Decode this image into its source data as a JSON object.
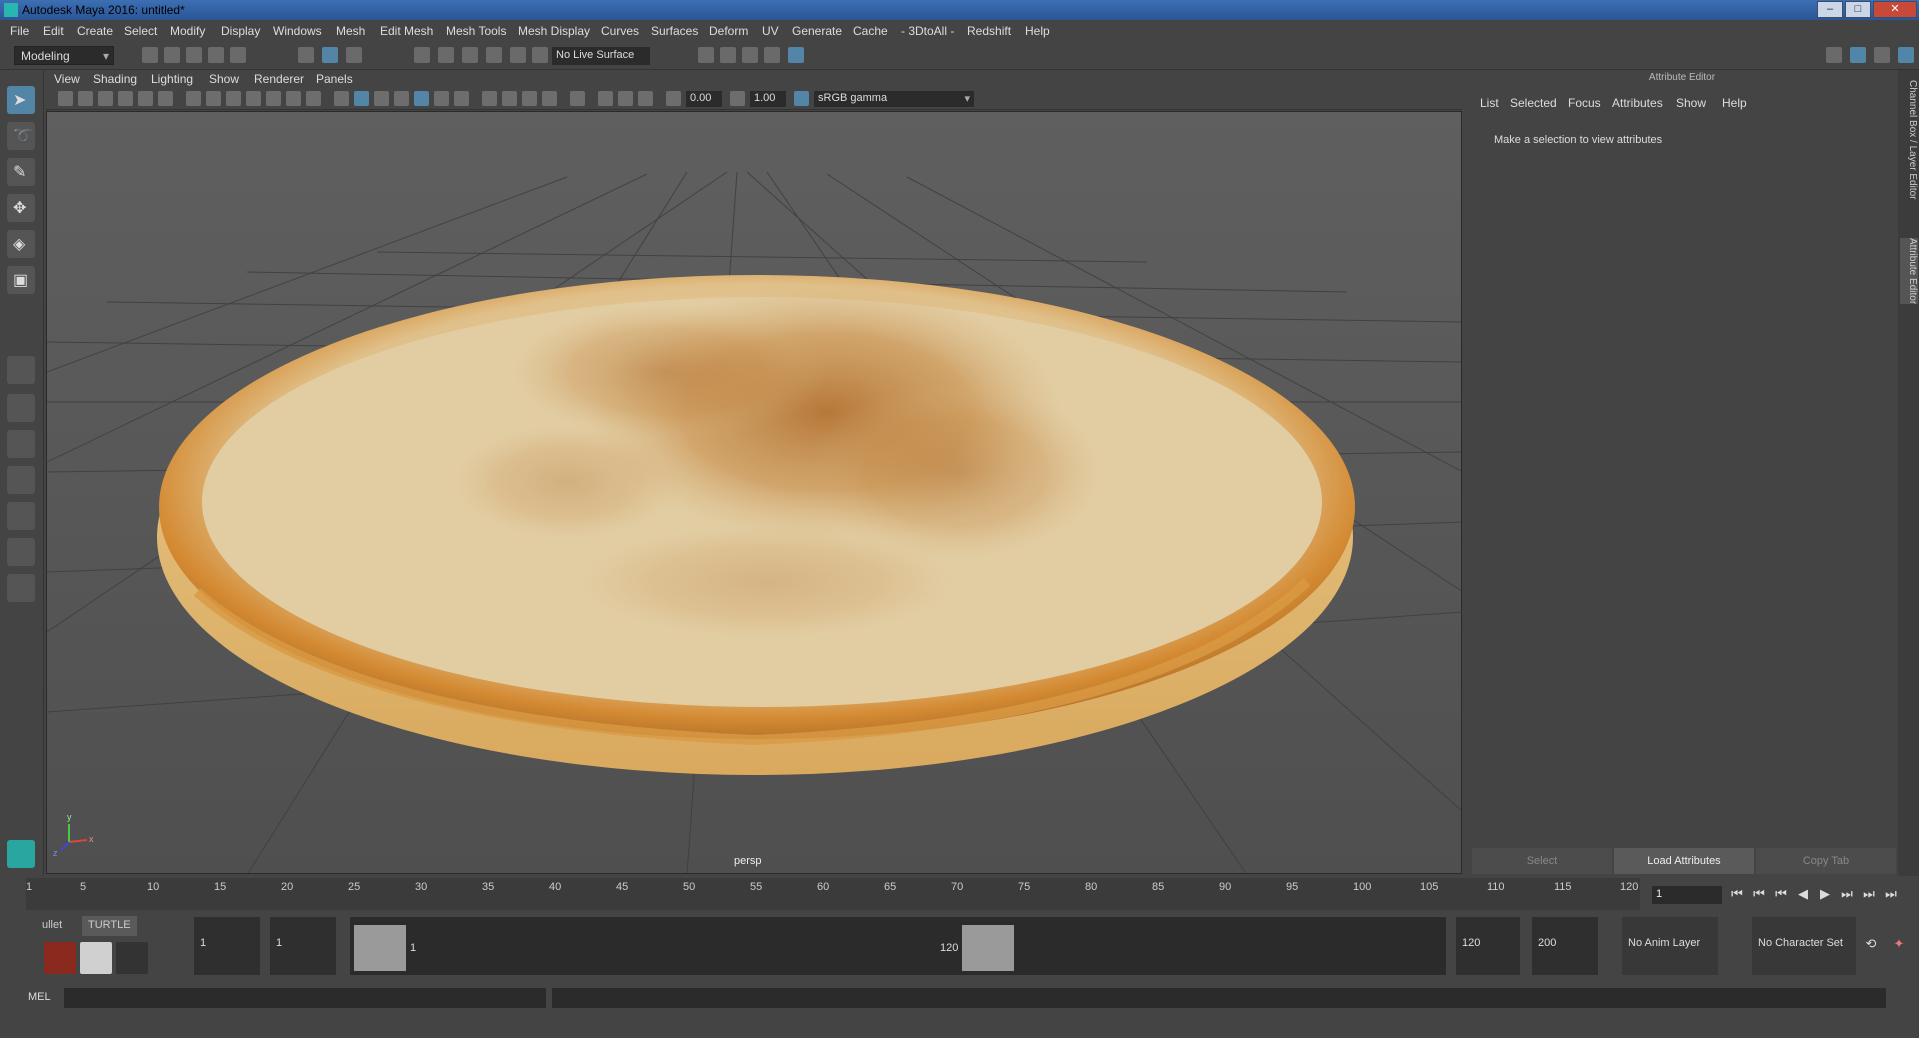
{
  "window": {
    "title": "Autodesk Maya 2016: untitled*",
    "min": "‒",
    "max": "□",
    "close": "✕"
  },
  "menubar": [
    "File",
    "Edit",
    "Create",
    "Select",
    "Modify",
    "Display",
    "Windows",
    "Mesh",
    "Edit Mesh",
    "Mesh Tools",
    "Mesh Display",
    "Curves",
    "Surfaces",
    "Deform",
    "UV",
    "Generate",
    "Cache",
    "- 3DtoAll -",
    "Redshift",
    "Help"
  ],
  "toolbar": {
    "mode": "Modeling",
    "live_surface": "No Live Surface"
  },
  "viewport": {
    "menu": [
      "View",
      "Shading",
      "Lighting",
      "Show",
      "Renderer",
      "Panels"
    ],
    "exposure": "0.00",
    "gamma_value": "1.00",
    "color_space": "sRGB gamma",
    "camera": "persp",
    "axis_labels": {
      "x": "x",
      "y": "y",
      "z": "z"
    }
  },
  "attribute_editor": {
    "header": "Attribute Editor",
    "menu": [
      "List",
      "Selected",
      "Focus",
      "Attributes",
      "Show",
      "Help"
    ],
    "message": "Make a selection to view attributes",
    "buttons": {
      "select": "Select",
      "load": "Load Attributes",
      "copy": "Copy Tab"
    },
    "side_tabs": [
      "Channel Box / Layer Editor",
      "Attribute Editor"
    ]
  },
  "timeline": {
    "ticks": [
      "1",
      "5",
      "10",
      "15",
      "20",
      "25",
      "30",
      "35",
      "40",
      "45",
      "50",
      "55",
      "60",
      "65",
      "70",
      "75",
      "80",
      "85",
      "90",
      "95",
      "100",
      "105",
      "110",
      "115",
      "120"
    ],
    "current_frame": "1",
    "playback_icons": [
      "⏮",
      "⏮",
      "⏮",
      "◀",
      "▶",
      "⏭",
      "⏭",
      "⏭"
    ]
  },
  "range": {
    "shelf_tabs": [
      "ullet",
      "TURTLE"
    ],
    "start": "1",
    "start_inner": "1",
    "slider_start": "1",
    "slider_end": "120",
    "end_inner": "120",
    "end": "200",
    "anim_layer": "No Anim Layer",
    "char_set": "No Character Set"
  },
  "command_line": {
    "label": "MEL"
  }
}
